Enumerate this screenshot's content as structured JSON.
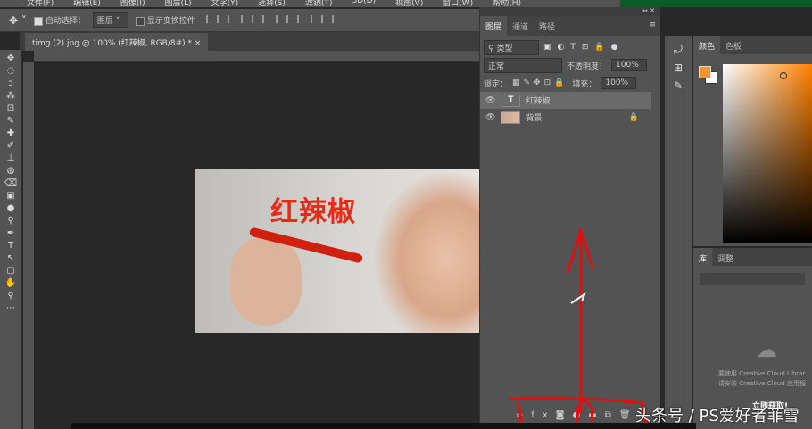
{
  "menu": [
    "文件(F)",
    "编辑(E)",
    "图像(I)",
    "图层(L)",
    "文字(Y)",
    "选择(S)",
    "滤镜(T)",
    "3D(D)",
    "视图(V)",
    "窗口(W)",
    "帮助(H)"
  ],
  "options": {
    "auto_select_label": "自动选择：",
    "auto_select_value": "图层",
    "show_transform_label": "显示变换控件"
  },
  "document_tab": {
    "title": "timg (2).jpg @ 100% (红辣椒, RGB/8#) *",
    "close": "×"
  },
  "tools": [
    "✥",
    "◌",
    "ↄ",
    "⁂",
    "⊡",
    "✎",
    "✚",
    "✐",
    "⊥",
    "◍",
    "⌫",
    "▣",
    "●",
    "⚲",
    "✒",
    "T",
    "↖",
    "▢",
    "✋",
    "⚲",
    "⋯"
  ],
  "image": {
    "title": "红辣椒"
  },
  "layers_panel": {
    "tabs": [
      "图层",
      "通道",
      "路径"
    ],
    "filter_label": "类型",
    "blend_mode": "正常",
    "opacity_label": "不透明度：",
    "opacity": "100%",
    "lock_label": "锁定：",
    "fill_label": "填充：",
    "fill": "100%",
    "layers": [
      {
        "name": "红辣椒",
        "type": "text",
        "thumb": "T"
      },
      {
        "name": "背景",
        "type": "image",
        "locked": true
      }
    ],
    "footer_icons": [
      "link-icon",
      "fx-icon",
      "mask-icon",
      "adjustment-icon",
      "folder-icon",
      "new-layer-icon",
      "trash-icon"
    ]
  },
  "color_panel": {
    "tabs": [
      "颜色",
      "色板"
    ],
    "foreground": "#f0963a",
    "background": "#ffffff",
    "hue": "#ff8000"
  },
  "library_panel": {
    "tabs": [
      "库",
      "调整"
    ],
    "message1": "要使用 Creative Cloud Librar",
    "message2": "请安装 Creative Cloud 应用程",
    "get_now": "立即获取!"
  },
  "watermark": "头条号 / PS爱好者菲雪",
  "annotation_color": "#e01010"
}
